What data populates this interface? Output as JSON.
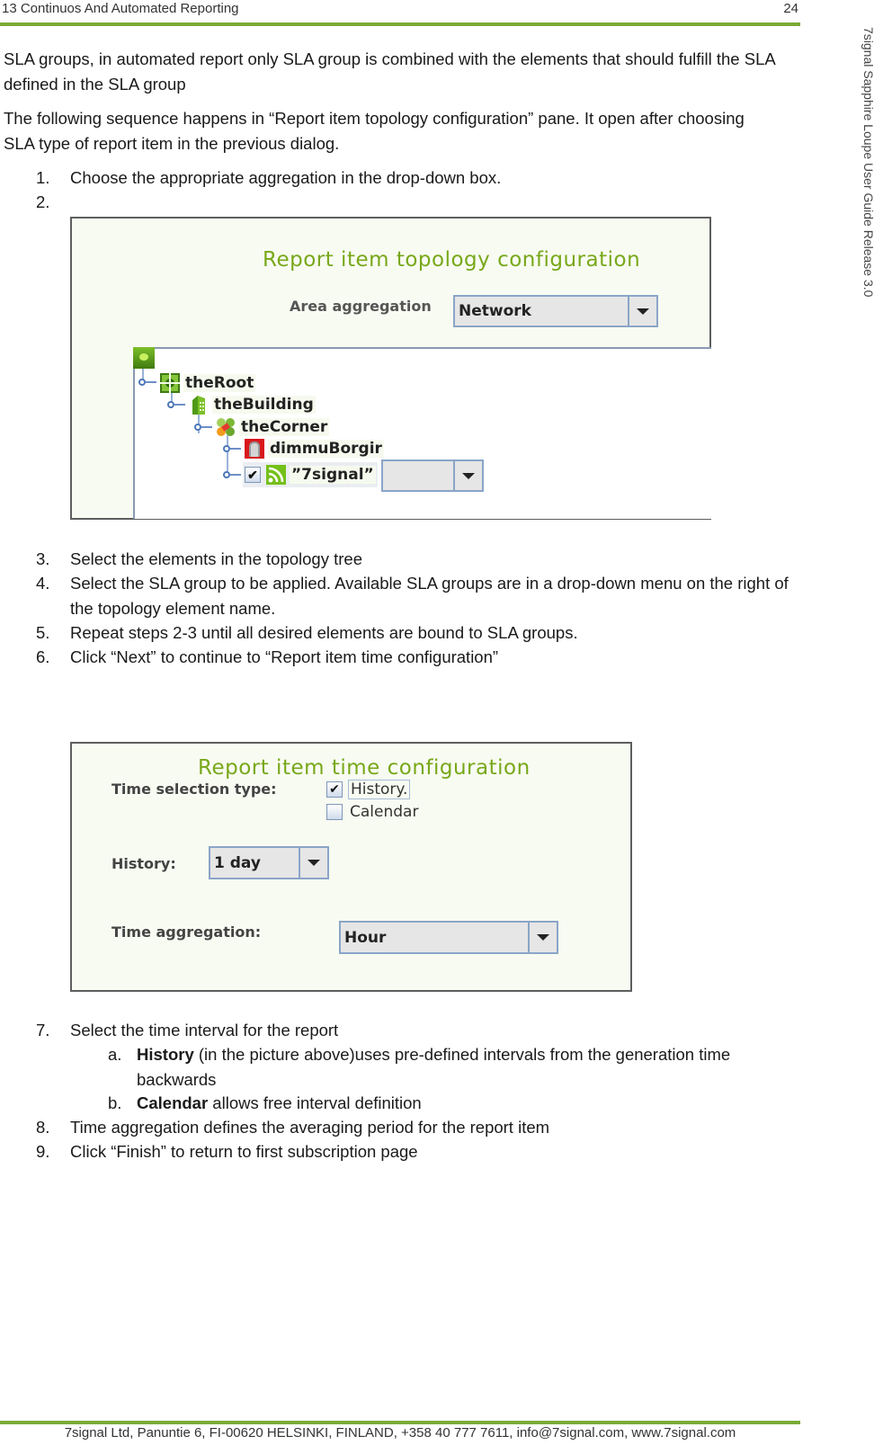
{
  "header": {
    "chapter_title": "13 Continuos And Automated Reporting",
    "page_number": "24",
    "accent_color": "#7aaa36"
  },
  "side_label": "7signal Sapphire Loupe User Guide Release 3.0",
  "intro": {
    "p1": "SLA groups, in automated report only SLA group is combined with the elements that should fulfill the SLA defined in the SLA group",
    "p2": "The following sequence happens in “Report item topology configuration” pane. It open after choosing SLA type of report item in the previous dialog."
  },
  "steps": [
    {
      "num": "1.",
      "text": "Choose the appropriate aggregation in the drop-down box."
    },
    {
      "num": "2.",
      "text": ""
    },
    {
      "num": "3.",
      "text": "Select the elements in the topology tree"
    },
    {
      "num": "4.",
      "text": "Select the SLA group to be applied. Available SLA groups are in a drop-down menu on the right of the topology element name."
    },
    {
      "num": "5.",
      "text": "Repeat steps 2-3 until all desired elements are bound to SLA groups."
    },
    {
      "num": "6.",
      "text": "Click “Next” to continue to “Report item time configuration”"
    },
    {
      "num": "7.",
      "text": "Select the time interval for the report"
    },
    {
      "num": "8.",
      "text": "Time aggregation defines the averaging period for the report item"
    },
    {
      "num": "9.",
      "text": "Click “Finish” to return to first subscription page"
    }
  ],
  "substeps": [
    {
      "letter": "a.",
      "bold": "History",
      "text": " (in the picture above)uses pre-defined intervals from the generation time backwards"
    },
    {
      "letter": "b.",
      "bold": "Calendar",
      "text": " allows free interval definition"
    }
  ],
  "topology_pane": {
    "title": "Report item topology configuration",
    "area_aggregation_label": "Area aggregation",
    "area_aggregation_value": "Network",
    "tree": [
      {
        "name": "theRoot",
        "icon": "network-root-icon"
      },
      {
        "name": "theBuilding",
        "icon": "building-icon"
      },
      {
        "name": "theCorner",
        "icon": "area-corner-icon"
      },
      {
        "name": "dimmuBorgir",
        "icon": "sensor-device-icon"
      },
      {
        "name": "”7signal”",
        "icon": "wifi-signal-icon",
        "checked": true,
        "sla_group_value": ""
      }
    ]
  },
  "time_pane": {
    "title": "Report item time configuration",
    "time_selection_label": "Time selection type:",
    "options": [
      {
        "label": "History.",
        "checked": true
      },
      {
        "label": "Calendar",
        "checked": false
      }
    ],
    "history_label": "History:",
    "history_value": "1 day",
    "time_aggregation_label": "Time aggregation:",
    "time_aggregation_value": "Hour"
  },
  "footer": {
    "text": "7signal Ltd, Panuntie 6, FI-00620 HELSINKI, FINLAND, +358 40 777 7611, info@7signal.com, www.7signal.com"
  }
}
